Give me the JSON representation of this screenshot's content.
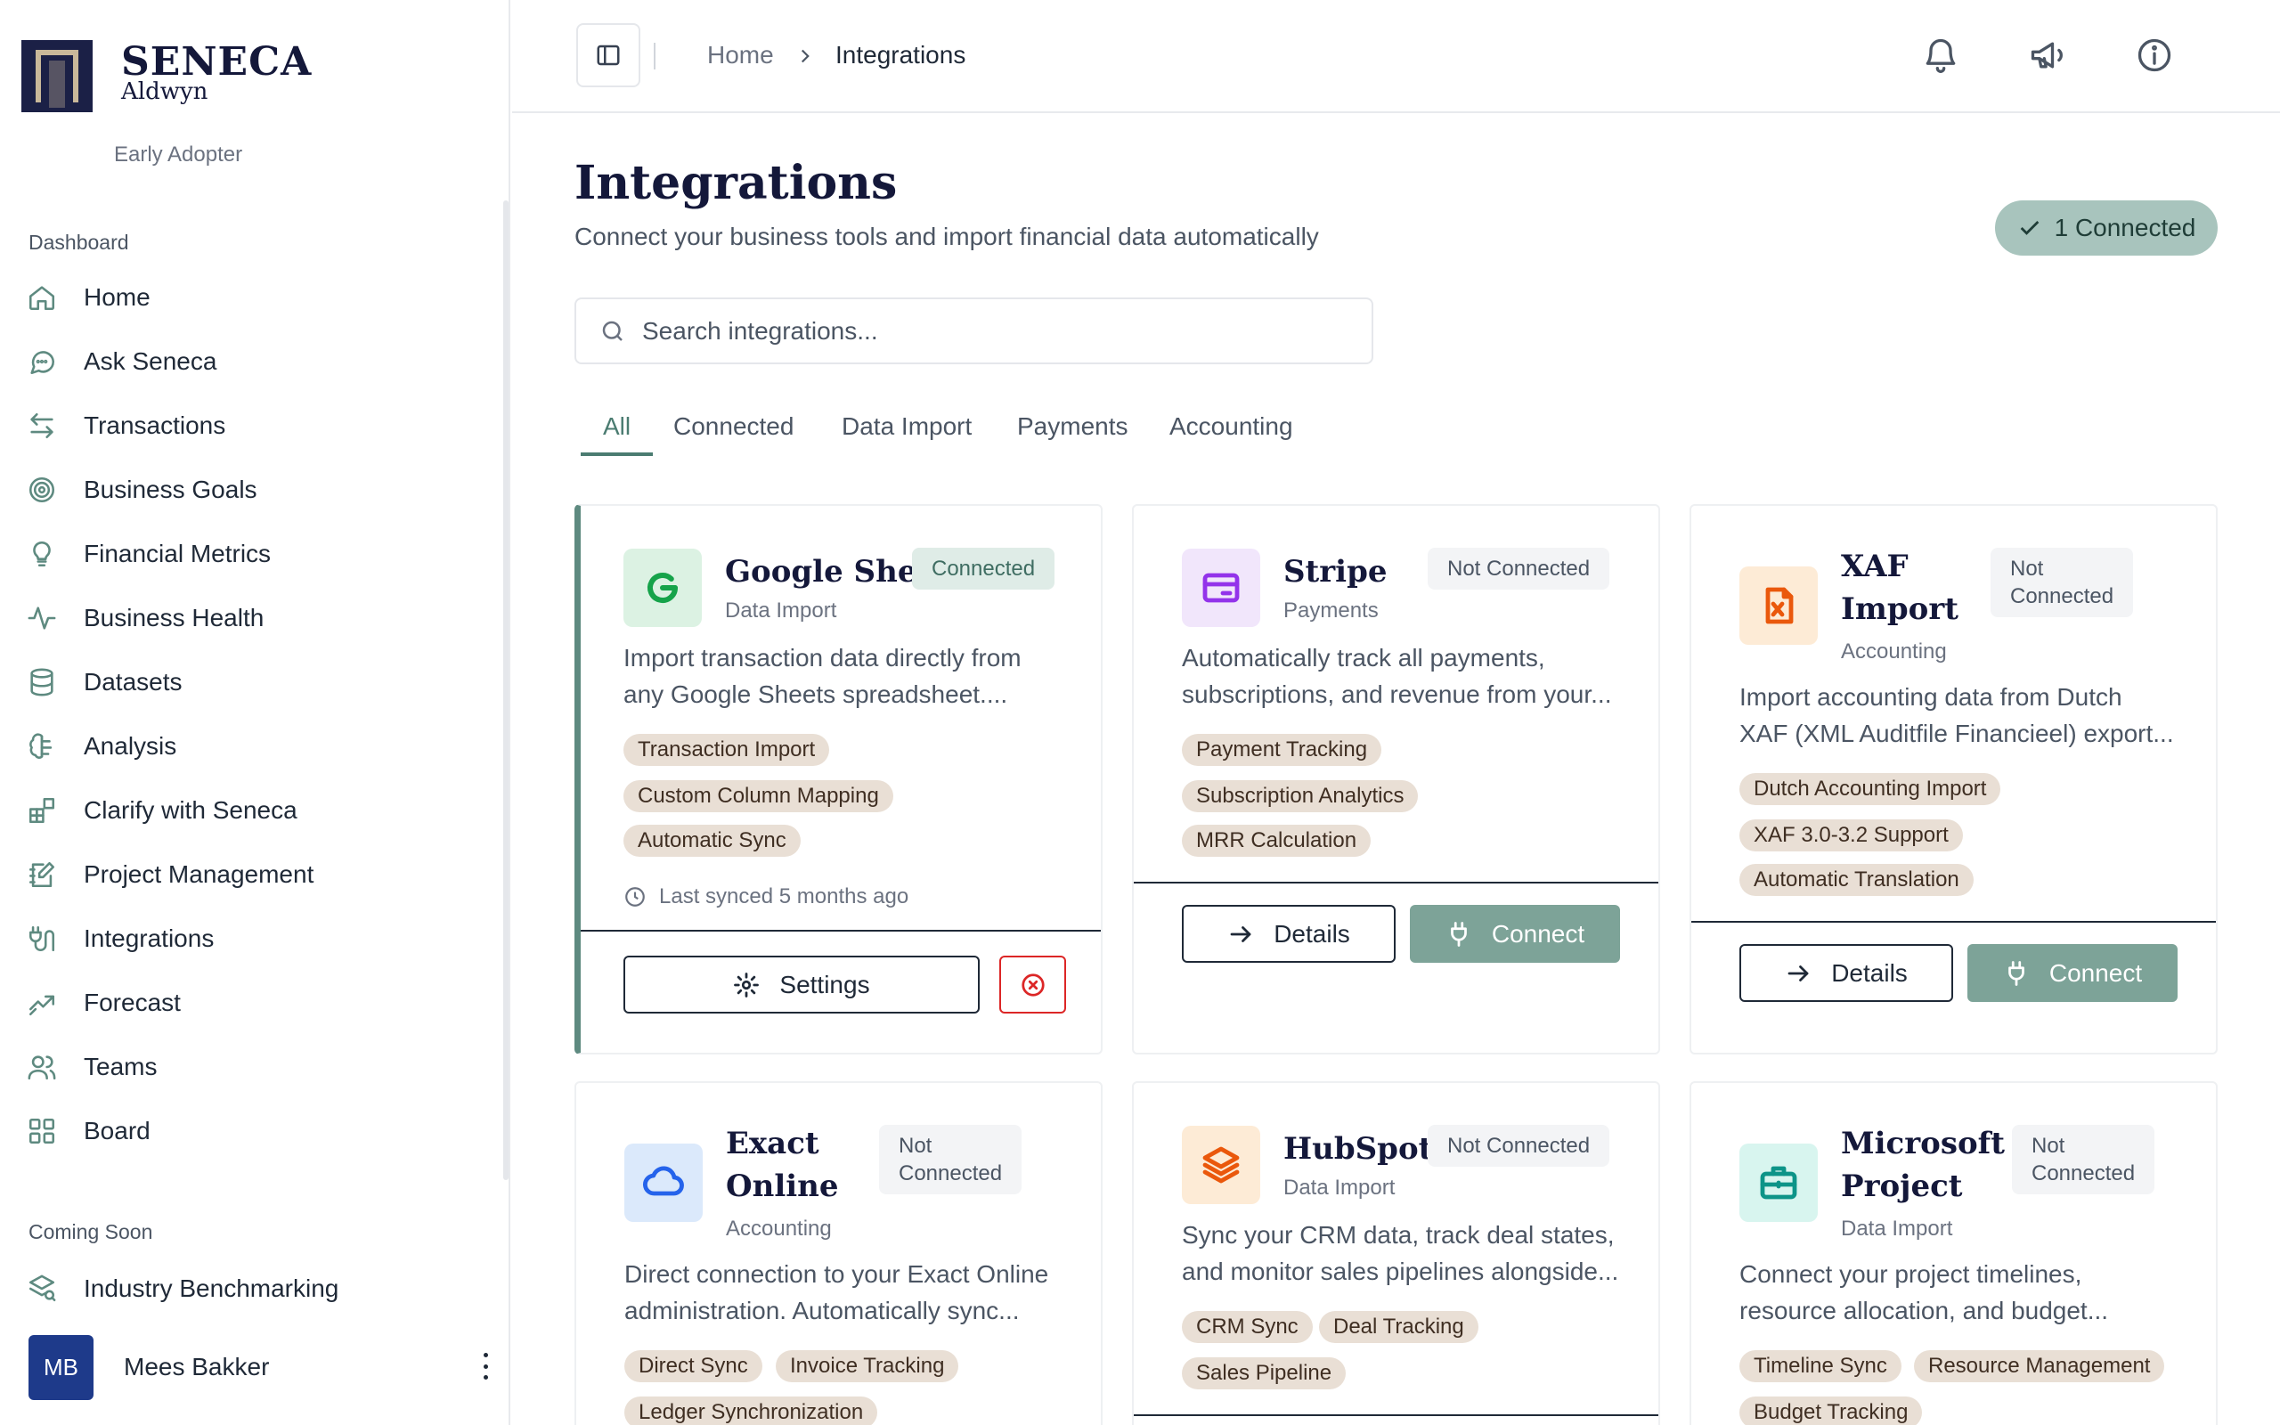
{
  "brand": {
    "name": "SENECA",
    "sub": "Aldwyn",
    "plan": "Early Adopter"
  },
  "sidebar": {
    "section_dashboard": "Dashboard",
    "items": [
      {
        "label": "Home",
        "icon": "home-icon"
      },
      {
        "label": "Ask Seneca",
        "icon": "chat-icon"
      },
      {
        "label": "Transactions",
        "icon": "arrows-icon"
      },
      {
        "label": "Business Goals",
        "icon": "target-icon"
      },
      {
        "label": "Financial Metrics",
        "icon": "lightbulb-icon"
      },
      {
        "label": "Business Health",
        "icon": "pulse-icon"
      },
      {
        "label": "Datasets",
        "icon": "database-icon"
      },
      {
        "label": "Analysis",
        "icon": "brain-icon"
      },
      {
        "label": "Clarify with Seneca",
        "icon": "blocks-icon"
      },
      {
        "label": "Project Management",
        "icon": "notebook-icon"
      },
      {
        "label": "Integrations",
        "icon": "plug-icon"
      },
      {
        "label": "Forecast",
        "icon": "trend-icon"
      },
      {
        "label": "Teams",
        "icon": "users-icon"
      },
      {
        "label": "Board",
        "icon": "grid-icon"
      }
    ],
    "section_soon": "Coming Soon",
    "soon_items": [
      {
        "label": "Industry Benchmarking",
        "icon": "benchmark-icon"
      }
    ],
    "user": {
      "initials": "MB",
      "name": "Mees Bakker"
    }
  },
  "breadcrumb": {
    "home": "Home",
    "current": "Integrations"
  },
  "page": {
    "title": "Integrations",
    "subtitle": "Connect your business tools and import financial data automatically",
    "connected_count_label": "1 Connected"
  },
  "search": {
    "placeholder": "Search integrations..."
  },
  "tabs": [
    "All",
    "Connected",
    "Data Import",
    "Payments",
    "Accounting"
  ],
  "cards": [
    {
      "title": "Google Sheets",
      "category": "Data Import",
      "status": "Connected",
      "description_1": "Import transaction data directly from",
      "description_2": "any Google Sheets spreadsheet....",
      "tags": [
        "Transaction Import",
        "Custom Column Mapping",
        "Automatic Sync"
      ],
      "sync": "Last synced 5 months ago",
      "primary_label": "Settings"
    },
    {
      "title": "Stripe",
      "category": "Payments",
      "status": "Not Connected",
      "description_1": "Automatically track all payments,",
      "description_2": "subscriptions, and revenue from your...",
      "tags": [
        "Payment Tracking",
        "Subscription Analytics",
        "MRR Calculation"
      ],
      "details_label": "Details",
      "connect_label": "Connect"
    },
    {
      "title_1": "XAF",
      "title_2": "Import",
      "category": "Accounting",
      "status_1": "Not",
      "status_2": "Connected",
      "description_1": "Import accounting data from Dutch",
      "description_2": "XAF (XML Auditfile Financieel) export...",
      "tags": [
        "Dutch Accounting Import",
        "XAF 3.0-3.2 Support",
        "Automatic Translation"
      ],
      "details_label": "Details",
      "connect_label": "Connect"
    },
    {
      "title_1": "Exact",
      "title_2": "Online",
      "category": "Accounting",
      "status_1": "Not",
      "status_2": "Connected",
      "description_1": "Direct connection to your Exact Online",
      "description_2": "administration. Automatically sync...",
      "tags": [
        "Direct Sync",
        "Invoice Tracking",
        "Ledger Synchronization"
      ]
    },
    {
      "title": "HubSpot",
      "category": "Data Import",
      "status": "Not Connected",
      "description_1": "Sync your CRM data, track deal states,",
      "description_2": "and monitor sales pipelines alongside...",
      "tags": [
        "CRM Sync",
        "Deal Tracking",
        "Sales Pipeline"
      ]
    },
    {
      "title_1": "Microsoft",
      "title_2": "Project",
      "category": "Data Import",
      "status_1": "Not",
      "status_2": "Connected",
      "description_1": "Connect your project timelines,",
      "description_2": "resource allocation, and budget...",
      "tags": [
        "Timeline Sync",
        "Resource Management",
        "Budget Tracking"
      ]
    }
  ],
  "colors": {
    "accent": "#5e8a80",
    "brand_navy": "#14183a",
    "tag_bg": "#e9dfd5",
    "danger": "#dc2626"
  }
}
